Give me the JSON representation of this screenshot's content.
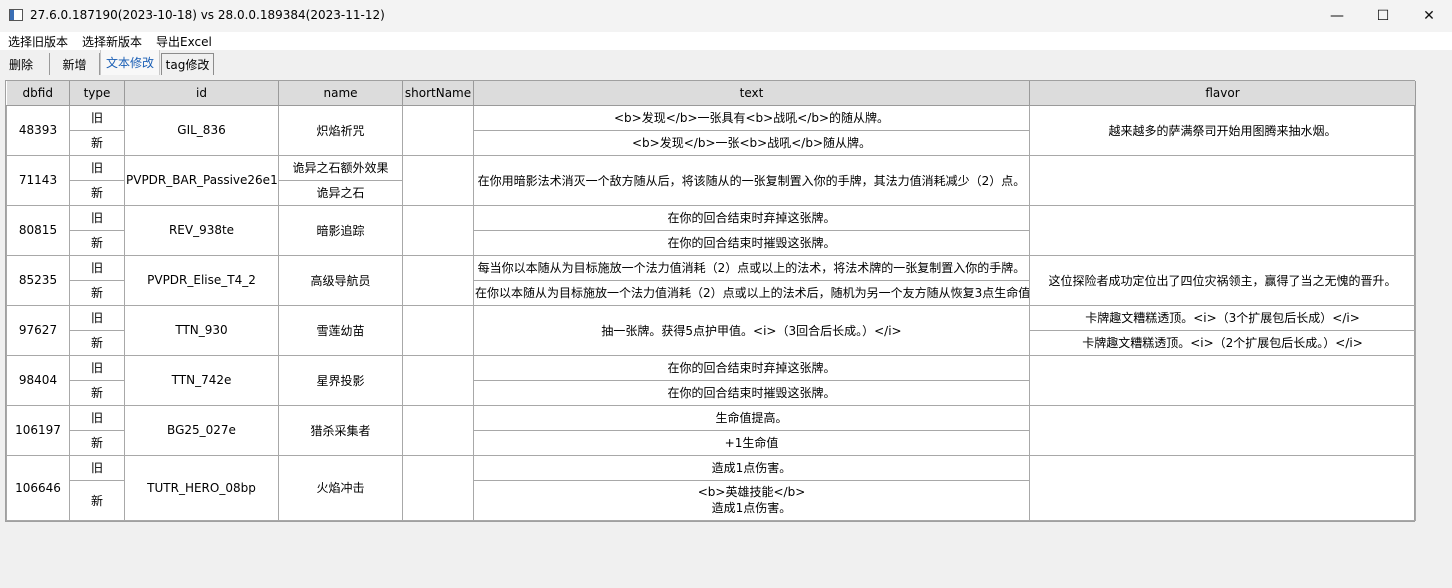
{
  "window": {
    "title": "27.6.0.187190(2023-10-18) vs 28.0.0.189384(2023-11-12)",
    "minimize_glyph": "—",
    "maximize_glyph": "☐",
    "close_glyph": "✕"
  },
  "menu": [
    "选择旧版本",
    "选择新版本",
    "导出Excel"
  ],
  "tabs": [
    "删除",
    "新增",
    "文本修改",
    "tag修改"
  ],
  "table": {
    "headers": [
      "dbfid",
      "type",
      "id",
      "name",
      "shortName",
      "text",
      "flavor"
    ],
    "groups": [
      {
        "dbfid": "48393",
        "id": "GIL_836",
        "rows": [
          {
            "type": "旧",
            "name": "炽焰祈咒",
            "text": "<b>发现</b>一张具有<b>战吼</b>的随从牌。",
            "flavor": "越来越多的萨满祭司开始用图腾来抽水烟。"
          },
          {
            "type": "新",
            "name": "炽焰祈咒",
            "text": "<b>发现</b>一张<b>战吼</b>随从牌。",
            "flavor": "越来越多的萨满祭司开始用图腾来抽水烟。"
          }
        ]
      },
      {
        "dbfid": "71143",
        "id": "PVPDR_BAR_Passive26e1",
        "rows": [
          {
            "type": "旧",
            "name": "诡异之石额外效果",
            "text": "在你用暗影法术消灭一个敌方随从后，将该随从的一张复制置入你的手牌，其法力值消耗减少（2）点。",
            "flavor": ""
          },
          {
            "type": "新",
            "name": "诡异之石",
            "text": "在你用暗影法术消灭一个敌方随从后，将该随从的一张复制置入你的手牌，其法力值消耗减少（2）点。",
            "flavor": ""
          }
        ]
      },
      {
        "dbfid": "80815",
        "id": "REV_938te",
        "rows": [
          {
            "type": "旧",
            "name": "暗影追踪",
            "text": "在你的回合结束时弃掉这张牌。",
            "flavor": ""
          },
          {
            "type": "新",
            "name": "暗影追踪",
            "text": "在你的回合结束时摧毁这张牌。",
            "flavor": ""
          }
        ]
      },
      {
        "dbfid": "85235",
        "id": "PVPDR_Elise_T4_2",
        "rows": [
          {
            "type": "旧",
            "name": "高级导航员",
            "text": "每当你以本随从为目标施放一个法力值消耗（2）点或以上的法术，将法术牌的一张复制置入你的手牌。",
            "flavor": "这位探险者成功定位出了四位灾祸领主，赢得了当之无愧的晋升。"
          },
          {
            "type": "新",
            "name": "高级导航员",
            "text": "在你以本随从为目标施放一个法力值消耗（2）点或以上的法术后，随机为另一个友方随从恢复3点生命值。",
            "flavor": "这位探险者成功定位出了四位灾祸领主，赢得了当之无愧的晋升。"
          }
        ]
      },
      {
        "dbfid": "97627",
        "id": "TTN_930",
        "rows": [
          {
            "type": "旧",
            "name": "雪莲幼苗",
            "text": "抽一张牌。获得5点护甲值。<i>（3回合后长成。）</i>",
            "flavor": "卡牌趣文糟糕透顶。<i>（3个扩展包后长成）</i>"
          },
          {
            "type": "新",
            "name": "雪莲幼苗",
            "text": "抽一张牌。获得5点护甲值。<i>（3回合后长成。）</i>",
            "flavor": "卡牌趣文糟糕透顶。<i>（2个扩展包后长成。）</i>"
          }
        ]
      },
      {
        "dbfid": "98404",
        "id": "TTN_742e",
        "rows": [
          {
            "type": "旧",
            "name": "星界投影",
            "text": "在你的回合结束时弃掉这张牌。",
            "flavor": ""
          },
          {
            "type": "新",
            "name": "星界投影",
            "text": "在你的回合结束时摧毁这张牌。",
            "flavor": ""
          }
        ]
      },
      {
        "dbfid": "106197",
        "id": "BG25_027e",
        "rows": [
          {
            "type": "旧",
            "name": "猎杀采集者",
            "text": "生命值提高。",
            "flavor": ""
          },
          {
            "type": "新",
            "name": "猎杀采集者",
            "text": "+1生命值",
            "flavor": ""
          }
        ]
      },
      {
        "dbfid": "106646",
        "id": "TUTR_HERO_08bp",
        "rows": [
          {
            "type": "旧",
            "name": "火焰冲击",
            "text": "造成1点伤害。",
            "flavor": ""
          },
          {
            "type": "新",
            "name": "火焰冲击",
            "text": "<b>英雄技能</b>\n造成1点伤害。",
            "flavor": ""
          }
        ]
      }
    ]
  }
}
